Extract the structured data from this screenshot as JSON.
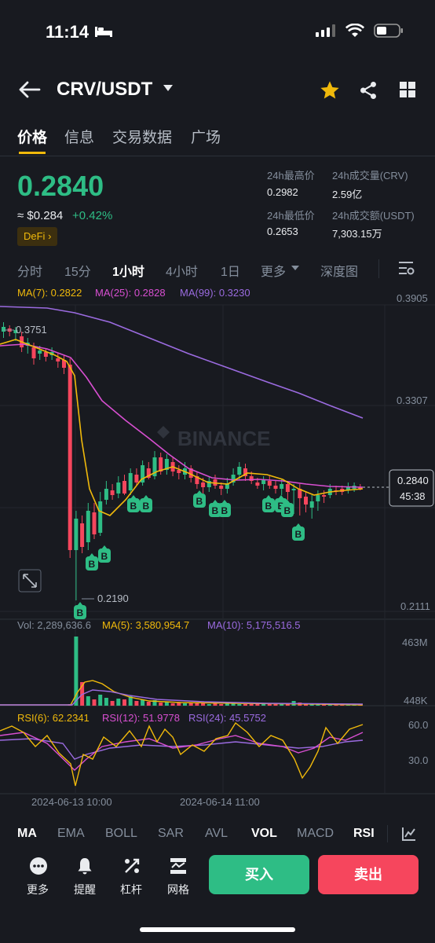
{
  "status_bar": {
    "time": "11:14"
  },
  "header": {
    "pair": "CRV/USDT"
  },
  "tabs": [
    "价格",
    "信息",
    "交易数据",
    "广场"
  ],
  "price": {
    "last": "0.2840",
    "approx": "≈ $0.284",
    "change": "+0.42%",
    "tag": "DeFi"
  },
  "stats": {
    "high_label": "24h最高价",
    "high_value": "0.2982",
    "vol_label": "24h成交量(CRV)",
    "vol_value": "2.59亿",
    "low_label": "24h最低价",
    "low_value": "0.2653",
    "amount_label": "24h成交额(USDT)",
    "amount_value": "7,303.15万"
  },
  "intervals": [
    "分时",
    "15分",
    "1小时",
    "4小时",
    "1日",
    "更多",
    "深度图"
  ],
  "chart": {
    "ma_legend": {
      "ma7": "MA(7): 0.2822",
      "ma25": "MA(25): 0.2828",
      "ma99": "MA(99): 0.3230"
    },
    "price_axis": [
      "0.3905",
      "0.3307",
      "0.2111"
    ],
    "current_price": "0.2840",
    "countdown": "45:38",
    "high_marker": "0.3751",
    "low_marker": "0.2190",
    "watermark": "BINANCE",
    "vol_legend": {
      "vol": "Vol: 2,289,636.6",
      "ma5": "MA(5): 3,580,954.7",
      "ma10": "MA(10): 5,175,516.5"
    },
    "vol_axis": [
      "463M",
      "448K"
    ],
    "rsi_legend": {
      "rsi6": "RSI(6): 62.2341",
      "rsi12": "RSI(12): 51.9778",
      "rsi24": "RSI(24): 45.5752"
    },
    "rsi_axis": [
      "60.0",
      "30.0"
    ],
    "dates": [
      "2024-06-13 10:00",
      "2024-06-14 11:00"
    ],
    "marker_letter": "B",
    "colors": {
      "up": "#2EBD85",
      "down": "#F6465D",
      "ma7": "#F0B90B",
      "ma25": "#D84FD1",
      "ma99": "#9B6BE0"
    }
  },
  "chart_data": {
    "type": "candlestick",
    "x": [
      "2024-06-13 10:00",
      "2024-06-14 11:00"
    ],
    "ylim": [
      0.2111,
      0.3905
    ],
    "series": [
      {
        "name": "MA(7)",
        "last": 0.2822
      },
      {
        "name": "MA(25)",
        "last": 0.2828
      },
      {
        "name": "MA(99)",
        "last": 0.323
      }
    ],
    "annotations": {
      "high": 0.3751,
      "low": 0.219,
      "last": 0.284
    }
  },
  "indicators": [
    "MA",
    "EMA",
    "BOLL",
    "SAR",
    "AVL",
    "VOL",
    "MACD",
    "RSI"
  ],
  "actions": {
    "more": "更多",
    "alert": "提醒",
    "leverage": "杠杆",
    "grid": "网格",
    "buy": "买入",
    "sell": "卖出"
  }
}
